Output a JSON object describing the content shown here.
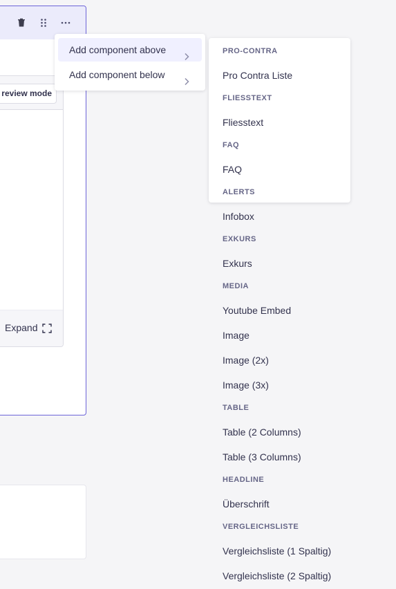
{
  "card": {
    "toolbar_icons": [
      "trash-icon",
      "drag-icon",
      "more-icon"
    ],
    "preview_button": "review mode",
    "expand_label": "Expand",
    "expand_icon": "expand-icon"
  },
  "menu": {
    "items": [
      {
        "label": "Add component above",
        "icon": "chevron-right-icon"
      },
      {
        "label": "Add component below",
        "icon": "chevron-right-icon"
      }
    ]
  },
  "submenu": {
    "groups": [
      {
        "name": "PRO-CONTRA",
        "items": [
          "Pro Contra Liste"
        ]
      },
      {
        "name": "FLIESSTEXT",
        "items": [
          "Fliesstext"
        ]
      },
      {
        "name": "FAQ",
        "items": [
          "FAQ"
        ]
      },
      {
        "name": "ALERTS",
        "items": [
          "Infobox"
        ]
      },
      {
        "name": "EXKURS",
        "items": [
          "Exkurs"
        ]
      },
      {
        "name": "MEDIA",
        "items": [
          "Youtube Embed",
          "Image",
          "Image (2x)",
          "Image (3x)"
        ]
      },
      {
        "name": "TABLE",
        "items": [
          "Table (2 Columns)",
          "Table (3 Columns)"
        ]
      },
      {
        "name": "HEADLINE",
        "items": [
          "Überschrift"
        ]
      },
      {
        "name": "VERGLEICHSLISTE",
        "items": [
          "Vergleichsliste (1 Spaltig)",
          "Vergleichsliste (2 Spaltig)"
        ]
      }
    ]
  }
}
